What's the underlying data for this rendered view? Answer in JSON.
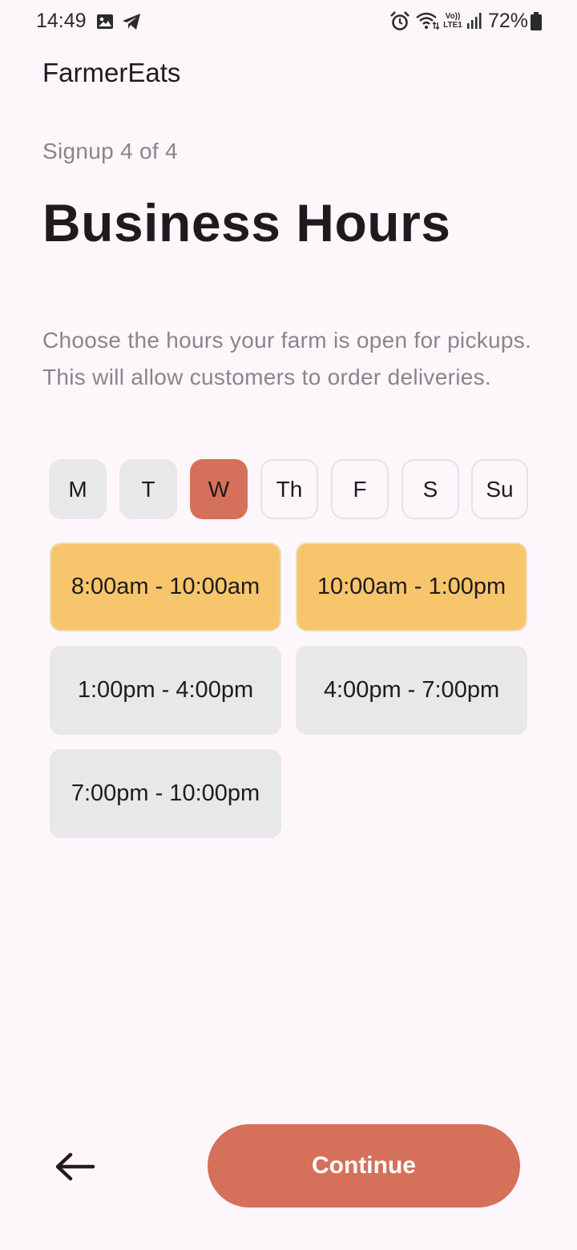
{
  "status_bar": {
    "time": "14:49",
    "battery_percent": "72%",
    "icons": [
      "image-icon",
      "telegram-icon",
      "alarm-icon",
      "wifi-icon",
      "volte-icon",
      "signal-icon",
      "battery-icon"
    ],
    "volte_label": "Vo))",
    "lte_label": "LTE1"
  },
  "app": {
    "name": "FarmerEats"
  },
  "page": {
    "step": "Signup 4 of 4",
    "title": "Business Hours",
    "description": "Choose the hours your farm is open for pickups. This will allow customers to order deliveries."
  },
  "days": [
    {
      "label": "M",
      "state": "filled"
    },
    {
      "label": "T",
      "state": "filled"
    },
    {
      "label": "W",
      "state": "selected"
    },
    {
      "label": "Th",
      "state": "outline"
    },
    {
      "label": "F",
      "state": "outline"
    },
    {
      "label": "S",
      "state": "outline"
    },
    {
      "label": "Su",
      "state": "outline"
    }
  ],
  "time_slots": [
    {
      "label": "8:00am - 10:00am",
      "selected": true
    },
    {
      "label": "10:00am - 1:00pm",
      "selected": true
    },
    {
      "label": "1:00pm - 4:00pm",
      "selected": false
    },
    {
      "label": "4:00pm - 7:00pm",
      "selected": false
    },
    {
      "label": "7:00pm - 10:00pm",
      "selected": false
    }
  ],
  "actions": {
    "back_icon": "arrow-left-icon",
    "continue_label": "Continue"
  },
  "colors": {
    "background": "#fdf7fc",
    "accent": "#d5705a",
    "slot_selected": "#f7c56b",
    "chip_gray": "#e8e7e9",
    "muted_text": "#8a8589"
  }
}
